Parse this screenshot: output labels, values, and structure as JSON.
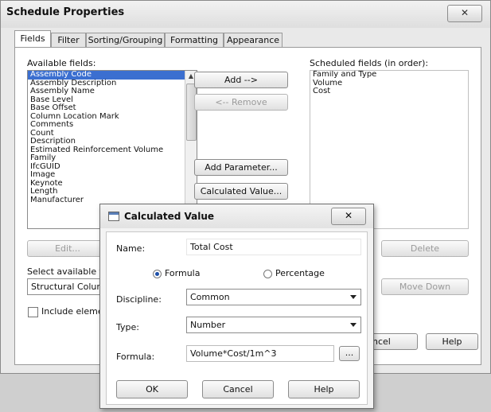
{
  "window": {
    "title": "Schedule Properties",
    "close_glyph": "✕"
  },
  "tabs": [
    {
      "label": "Fields"
    },
    {
      "label": "Filter"
    },
    {
      "label": "Sorting/Grouping"
    },
    {
      "label": "Formatting"
    },
    {
      "label": "Appearance"
    }
  ],
  "fields_tab": {
    "available_label": "Available fields:",
    "available_fields": [
      "Assembly Code",
      "Assembly Description",
      "Assembly Name",
      "Base Level",
      "Base Offset",
      "Column Location Mark",
      "Comments",
      "Count",
      "Description",
      "Estimated Reinforcement Volume",
      "Family",
      "IfcGUID",
      "Image",
      "Keynote",
      "Length",
      "Manufacturer"
    ],
    "selected_available": "Assembly Code",
    "scheduled_label": "Scheduled fields (in order):",
    "scheduled_fields": [
      "Family and Type",
      "Volume",
      "Cost"
    ],
    "add_button": "Add -->",
    "remove_button": "<-- Remove",
    "add_parameter_button": "Add Parameter...",
    "calculated_value_button": "Calculated Value...",
    "edit_button": "Edit...",
    "delete_button": "Delete",
    "select_available_label": "Select available fie",
    "select_available_value": "Structural Colum",
    "move_down_button": "Move Down",
    "include_elements_label": "Include elemen",
    "cancel_button_partial": "ncel",
    "help_button": "Help"
  },
  "calc_dialog": {
    "title": "Calculated Value",
    "close_glyph": "✕",
    "name_label": "Name:",
    "name_value": "Total Cost",
    "formula_option": "Formula",
    "percentage_option": "Percentage",
    "selected_option": "Formula",
    "discipline_label": "Discipline:",
    "discipline_value": "Common",
    "type_label": "Type:",
    "type_value": "Number",
    "formula_label": "Formula:",
    "formula_value": "Volume*Cost/1m^3",
    "browse_button": "...",
    "ok_button": "OK",
    "cancel_button": "Cancel",
    "help_button": "Help"
  }
}
